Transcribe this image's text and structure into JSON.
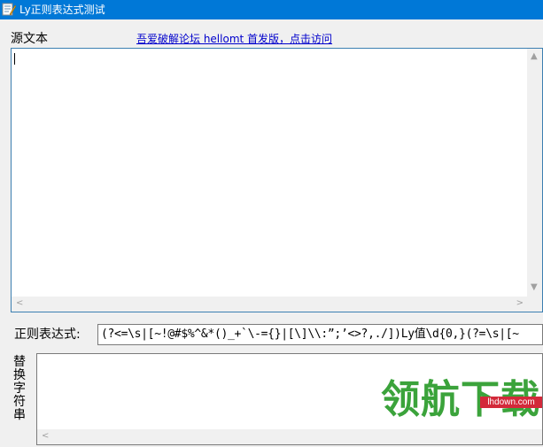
{
  "window": {
    "title": "Ly正则表达式测试",
    "icon": "app-edit-icon"
  },
  "source": {
    "label": "源文本",
    "link_text": "吾爱破解论坛 hellomt 首发版，点击访问",
    "value": ""
  },
  "regex": {
    "label": "正则表达式:",
    "value": "(?<=\\s|[~!@#$%^&*()_+`\\-={}|[\\]\\\\:”;’<>?,./])Ly值\\d{0,}(?=\\s|[~"
  },
  "replace": {
    "label": "替换字符串",
    "value": ""
  },
  "watermark": {
    "text": "领航下载",
    "badge": "lhdown.com"
  },
  "colors": {
    "titlebar": "#0078d7",
    "link": "#0000cc",
    "focus_border": "#3c7fb1",
    "watermark_green": "#3ba33b",
    "watermark_red": "#d3293a"
  }
}
